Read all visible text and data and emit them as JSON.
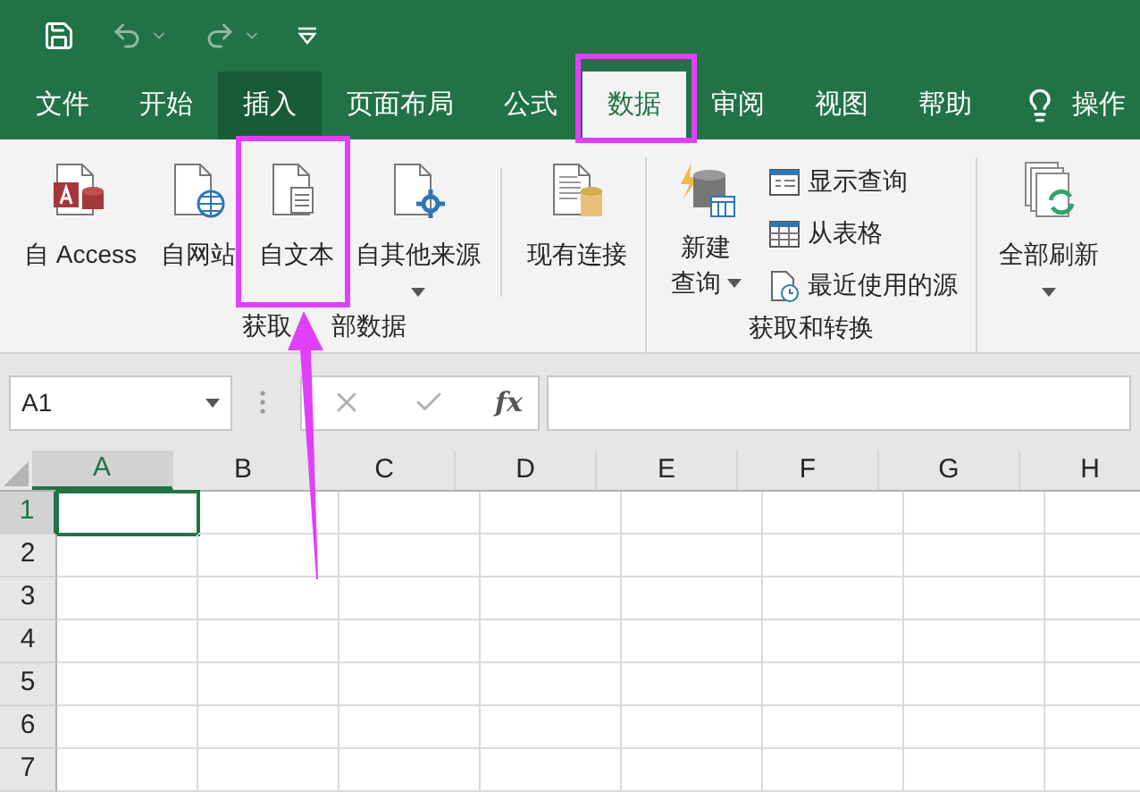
{
  "tabs": [
    {
      "label": "文件",
      "selected": false,
      "hovered": false
    },
    {
      "label": "开始",
      "selected": false,
      "hovered": false
    },
    {
      "label": "插入",
      "selected": false,
      "hovered": true
    },
    {
      "label": "页面布局",
      "selected": false,
      "hovered": false
    },
    {
      "label": "公式",
      "selected": false,
      "hovered": false
    },
    {
      "label": "数据",
      "selected": true,
      "hovered": false
    },
    {
      "label": "审阅",
      "selected": false,
      "hovered": false
    },
    {
      "label": "视图",
      "selected": false,
      "hovered": false
    },
    {
      "label": "帮助",
      "selected": false,
      "hovered": false
    }
  ],
  "tell_me": "操作",
  "ribbon": {
    "groups": [
      {
        "label": [
          "获取",
          "部数据"
        ],
        "buttons": [
          {
            "kind": "large",
            "label": "自 Access",
            "dropdown": false
          },
          {
            "kind": "large",
            "label": "自网站",
            "dropdown": false
          },
          {
            "kind": "large",
            "label": "自文本",
            "dropdown": false
          },
          {
            "kind": "large",
            "label": "自其他来源",
            "dropdown": true
          },
          {
            "kind": "separator"
          },
          {
            "kind": "large",
            "label": "现有连接",
            "dropdown": false
          }
        ]
      },
      {
        "label": [
          "获取和转换"
        ],
        "buttons": [
          {
            "kind": "stacked",
            "lines": [
              "新建",
              "查询"
            ],
            "dropdown": true
          },
          {
            "kind": "small",
            "label": "显示查询"
          },
          {
            "kind": "small",
            "label": "从表格"
          },
          {
            "kind": "small",
            "label": "最近使用的源"
          }
        ]
      },
      {
        "buttons": [
          {
            "kind": "large",
            "label": "全部刷新",
            "dropdown": true
          }
        ]
      }
    ]
  },
  "name_box": "A1",
  "function_label": "fx",
  "sheet": {
    "columns": [
      {
        "label": "A",
        "selected": true
      },
      {
        "label": "B",
        "selected": false
      },
      {
        "label": "C",
        "selected": false
      },
      {
        "label": "D",
        "selected": false
      },
      {
        "label": "E",
        "selected": false
      },
      {
        "label": "F",
        "selected": false
      },
      {
        "label": "G",
        "selected": false
      },
      {
        "label": "H",
        "selected": false
      }
    ],
    "rows": [
      {
        "label": "1",
        "selected": true
      },
      {
        "label": "2",
        "selected": false
      },
      {
        "label": "3",
        "selected": false
      },
      {
        "label": "4",
        "selected": false
      },
      {
        "label": "5",
        "selected": false
      },
      {
        "label": "6",
        "selected": false
      },
      {
        "label": "7",
        "selected": false
      }
    ]
  },
  "annotations": [
    {
      "kind": "frame"
    },
    {
      "kind": "frame"
    },
    {
      "kind": "arrow"
    }
  ]
}
